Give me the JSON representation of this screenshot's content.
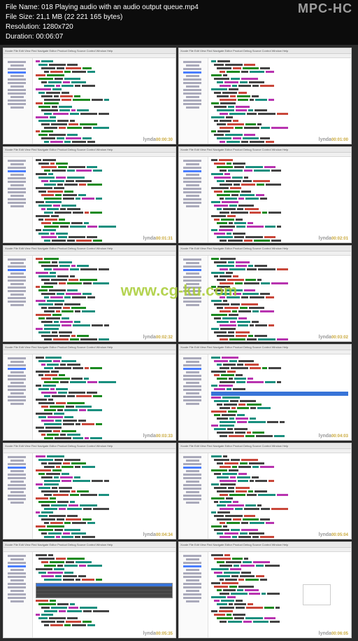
{
  "header": {
    "filename_label": "File Name:",
    "filename": "018 Playing audio with an audio output queue.mp4",
    "filesize_label": "File Size:",
    "filesize": "21,1 MB (22 221 165 bytes)",
    "resolution_label": "Resolution:",
    "resolution": "1280x720",
    "duration_label": "Duration:",
    "duration": "00:06:07",
    "app_logo": "MPC-HC"
  },
  "watermark_url": "www.cg-ku.com",
  "thumb_watermark": "lynda",
  "menubar": "Xcode File Edit View Find Navigate Editor Product Debug Source Control Window Help",
  "thumbnails": [
    {
      "timestamp": "00:00:30"
    },
    {
      "timestamp": "00:01:00"
    },
    {
      "timestamp": "00:01:31"
    },
    {
      "timestamp": "00:02:01"
    },
    {
      "timestamp": "00:02:32"
    },
    {
      "timestamp": "00:03:02"
    },
    {
      "timestamp": "00:03:33"
    },
    {
      "timestamp": "00:04:03",
      "has_highlight": true
    },
    {
      "timestamp": "00:04:34"
    },
    {
      "timestamp": "00:05:04"
    },
    {
      "timestamp": "00:05:35",
      "has_autocomplete": true
    },
    {
      "timestamp": "00:06:05",
      "has_preview": true
    }
  ]
}
